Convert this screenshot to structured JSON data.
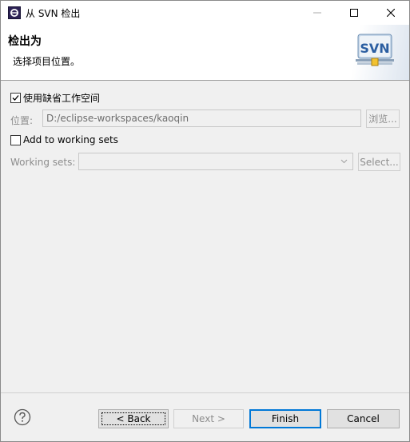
{
  "window": {
    "title": "从 SVN 检出"
  },
  "banner": {
    "title": "检出为",
    "description": "选择项目位置。",
    "logo_text": "SVN"
  },
  "use_default_workspace": {
    "label": "使用缺省工作空间",
    "checked": true
  },
  "location": {
    "label": "位置:",
    "value": "D:/eclipse-workspaces/kaoqin",
    "browse_label": "浏览..."
  },
  "working_sets": {
    "checkbox_label": "Add to working sets",
    "checked": false,
    "label": "Working sets:",
    "value": "",
    "select_label": "Select..."
  },
  "footer": {
    "back_label": "< Back",
    "next_label": "Next >",
    "finish_label": "Finish",
    "cancel_label": "Cancel"
  },
  "colors": {
    "accent": "#0078d7",
    "disabled_text": "#8d8d8d",
    "dialog_bg": "#f0f0f0"
  }
}
